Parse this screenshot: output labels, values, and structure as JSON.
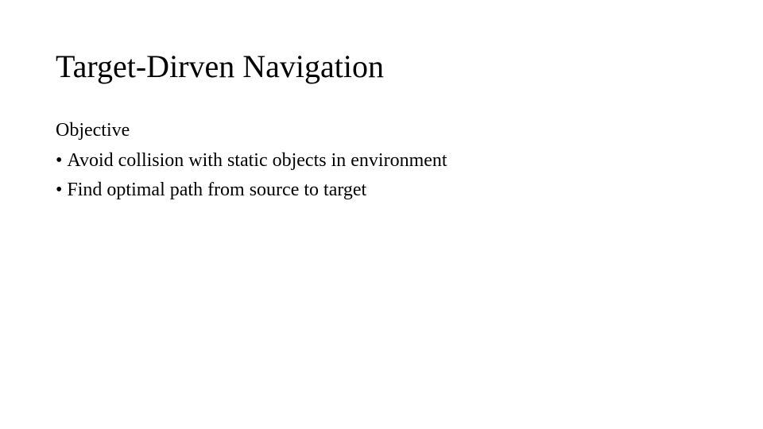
{
  "slide": {
    "title": "Target-Dirven Navigation",
    "subheading": "Objective",
    "bullets": [
      "Avoid collision with static objects in environment",
      "Find optimal path from source to target"
    ]
  }
}
